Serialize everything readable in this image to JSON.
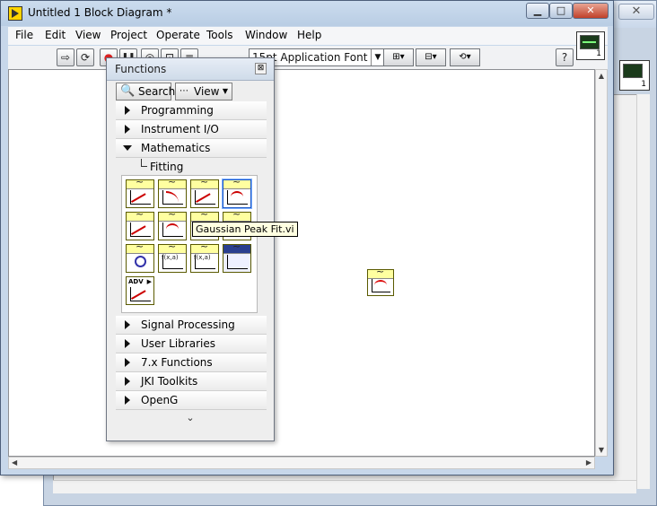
{
  "window": {
    "title": "Untitled 1 Block Diagram *",
    "controls": {
      "minimize": "▁",
      "maximize": "□",
      "close": "✕"
    }
  },
  "menu": [
    "File",
    "Edit",
    "View",
    "Project",
    "Operate",
    "Tools",
    "Window",
    "Help"
  ],
  "toolbar": {
    "run": "⇨",
    "run_continuous": "⟳",
    "abort": "●",
    "pause": "❚❚",
    "highlight": "◎",
    "retain": "⊡",
    "step": "≡",
    "font": "15pt Application Font",
    "font_arrow": "▼",
    "align": "⊞▾",
    "distribute": "⊟▾",
    "reorder": "⟲▾",
    "help": "?"
  },
  "vi_icon_number": "1",
  "palette": {
    "title": "Functions",
    "close": "⊠",
    "search_label": "Search",
    "view_label": "View",
    "search_icon": "magnifier",
    "categories_top": [
      {
        "label": "Programming",
        "expanded": false
      },
      {
        "label": "Instrument I/O",
        "expanded": false
      },
      {
        "label": "Mathematics",
        "expanded": true
      }
    ],
    "subcategory": "Fitting",
    "categories_bottom": [
      {
        "label": "Signal Processing"
      },
      {
        "label": "User Libraries"
      },
      {
        "label": "7.x Functions"
      },
      {
        "label": "JKI Toolkits"
      },
      {
        "label": "OpenG"
      }
    ],
    "tooltip": "Gaussian Peak Fit.vi",
    "adv_label": "ADV",
    "fx_label": "f(x,a)",
    "more": "⌄"
  },
  "bg_window": {
    "close": "✕",
    "icon_number": "1"
  }
}
